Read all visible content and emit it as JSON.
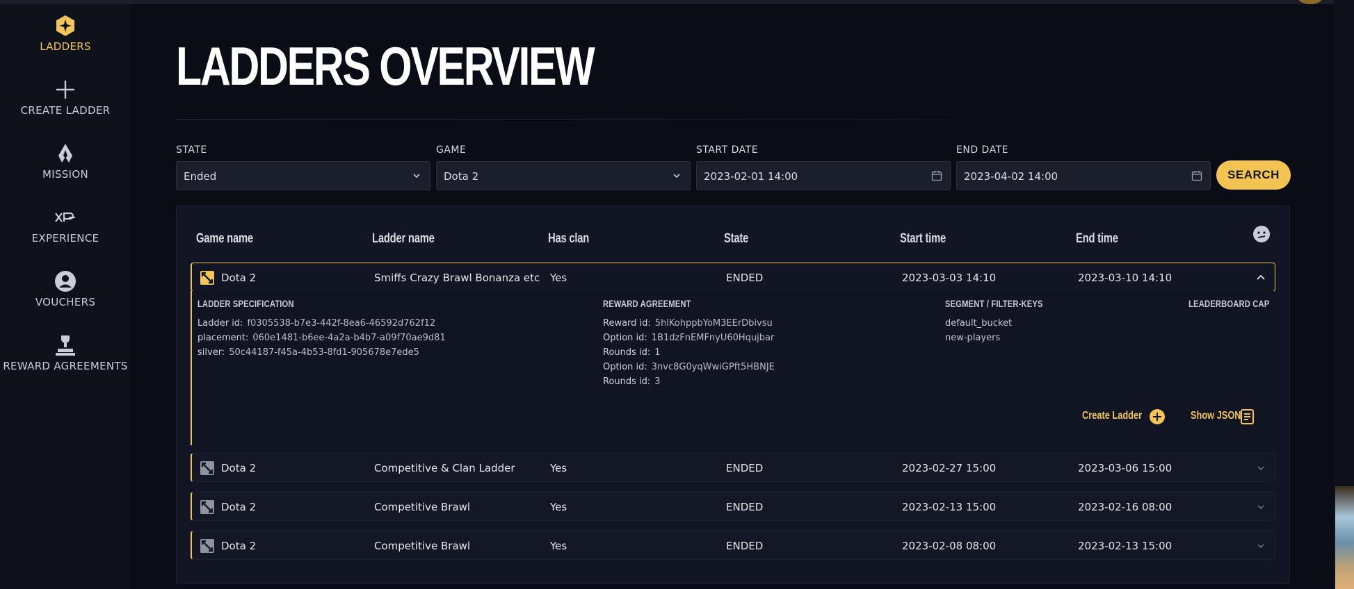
{
  "sidebar": {
    "items": [
      {
        "label": "LADDERS",
        "icon": "ladders-star-icon",
        "active": true
      },
      {
        "label": "CREATE LADDER",
        "icon": "plus-icon",
        "active": false
      },
      {
        "label": "MISSION",
        "icon": "mission-flame-icon",
        "active": false
      },
      {
        "label": "EXPERIENCE",
        "icon": "xp-icon",
        "active": false
      },
      {
        "label": "VOUCHERS",
        "icon": "user-circle-icon",
        "active": false
      },
      {
        "label": "REWARD AGREEMENTS",
        "icon": "trophy-podium-icon",
        "active": false
      }
    ]
  },
  "page": {
    "title": "LADDERS OVERVIEW"
  },
  "filters": {
    "state": {
      "label": "STATE",
      "value": "Ended"
    },
    "game": {
      "label": "GAME",
      "value": "Dota 2"
    },
    "start_date": {
      "label": "START DATE",
      "value": "2023-02-01 14:00"
    },
    "end_date": {
      "label": "END DATE",
      "value": "2023-04-02 14:00"
    },
    "search_label": "SEARCH"
  },
  "table": {
    "columns": [
      "Game name",
      "Ladder name",
      "Has clan",
      "State",
      "Start time",
      "End time"
    ],
    "rows": [
      {
        "game": "Dota 2",
        "ladder": "Smiffs Crazy Brawl Bonanza etc",
        "has_clan": "Yes",
        "state": "ENDED",
        "start": "2023-03-03 14:10",
        "end": "2023-03-10 14:10",
        "expanded": true
      },
      {
        "game": "Dota 2",
        "ladder": "Competitive & Clan Ladder",
        "has_clan": "Yes",
        "state": "ENDED",
        "start": "2023-02-27 15:00",
        "end": "2023-03-06 15:00",
        "expanded": false
      },
      {
        "game": "Dota 2",
        "ladder": "Competitive Brawl",
        "has_clan": "Yes",
        "state": "ENDED",
        "start": "2023-02-13 15:00",
        "end": "2023-02-16 08:00",
        "expanded": false
      },
      {
        "game": "Dota 2",
        "ladder": "Competitive Brawl",
        "has_clan": "Yes",
        "state": "ENDED",
        "start": "2023-02-08 08:00",
        "end": "2023-02-13 15:00",
        "expanded": false
      }
    ]
  },
  "details": {
    "spec_title": "LADDER SPECIFICATION",
    "spec": [
      {
        "k": "Ladder id:",
        "v": "f0305538-b7e3-442f-8ea6-46592d762f12"
      },
      {
        "k": "placement:",
        "v": "060e1481-b6ee-4a2a-b4b7-a09f70ae9d81"
      },
      {
        "k": "silver:",
        "v": "50c44187-f45a-4b53-8fd1-905678e7ede5"
      }
    ],
    "reward_title": "REWARD AGREEMENT",
    "reward": [
      {
        "k": "Reward id:",
        "v": "5hlKohppbYoM3EErDbivsu"
      },
      {
        "k": "Option id:",
        "v": "1B1dzFnEMFnyU60Hqujbar"
      },
      {
        "k": "Rounds id:",
        "v": "1"
      },
      {
        "k": "Option id:",
        "v": "3nvc8G0yqWwiGPft5HBNJE"
      },
      {
        "k": "Rounds id:",
        "v": "3"
      }
    ],
    "segment_title": "SEGMENT / FILTER-KEYS",
    "segments": [
      "default_bucket",
      "new-players"
    ],
    "cap_title": "LEADERBOARD CAP",
    "create_ladder_label": "Create Ladder",
    "show_json_label": "Show JSON"
  },
  "colors": {
    "accent": "#f4c452",
    "bg": "#0a0d15",
    "sidebar": "#0f121b",
    "panel": "#121624"
  }
}
